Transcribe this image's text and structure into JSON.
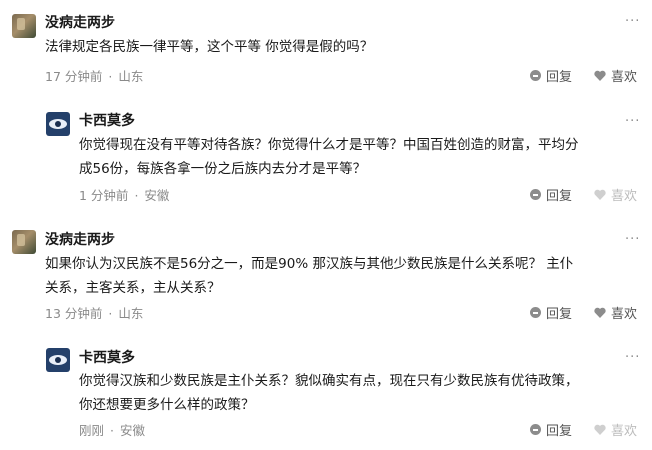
{
  "comments": [
    {
      "author": "没病走两步",
      "text": "法律规定各民族一律平等，这个平等 你觉得是假的吗？",
      "time": "17 分钟前",
      "location": "山东",
      "reply_label": "回复",
      "like_label": "喜欢"
    },
    {
      "author": "卡西莫多",
      "text_lines": [
        "你觉得现在没有平等对待各族？你觉得什么才是平等？中国百姓创造的财富，平均分",
        "成56份，每族各拿一份之后族内去分才是平等？"
      ],
      "time": "1 分钟前",
      "location": "安徽",
      "reply_label": "回复",
      "like_label": "喜欢"
    },
    {
      "author": "没病走两步",
      "text_lines": [
        "如果你认为汉民族不是56分之一，而是90% 那汉族与其他少数民族是什么关系呢？ 主仆",
        "关系，主客关系，主从关系？"
      ],
      "time": "13 分钟前",
      "location": "山东",
      "reply_label": "回复",
      "like_label": "喜欢"
    },
    {
      "author": "卡西莫多",
      "text_lines": [
        "你觉得汉族和少数民族是主仆关系？貌似确实有点，现在只有少数民族有优待政策，",
        "你还想要更多什么样的政策？"
      ],
      "time": "刚刚",
      "location": "安徽",
      "reply_label": "回复",
      "like_label": "喜欢"
    }
  ],
  "more_glyph": "···",
  "separator": "·",
  "colors": {
    "muted": "#8a8a8a",
    "text": "#1a1a1a",
    "disabled": "#bcbcbc"
  }
}
